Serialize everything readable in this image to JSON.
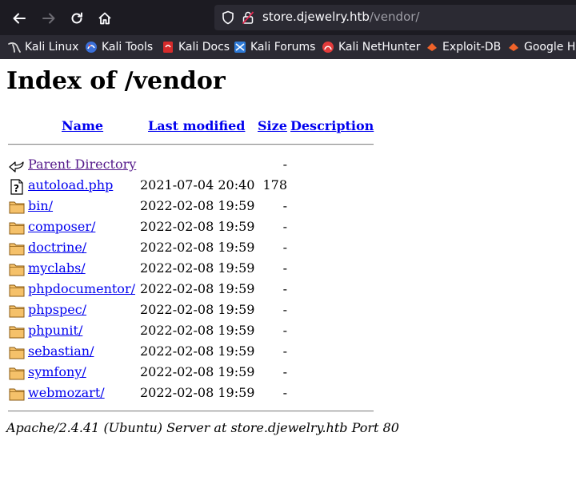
{
  "browser": {
    "url_host": "store.djewelry.htb",
    "url_path": "/vendor/",
    "bookmarks": [
      {
        "label": "Kali Linux",
        "icon": "kali-dragon-icon"
      },
      {
        "label": "Kali Tools",
        "icon": "kali-tools-icon"
      },
      {
        "label": "Kali Docs",
        "icon": "kali-docs-icon"
      },
      {
        "label": "Kali Forums",
        "icon": "kali-forums-icon"
      },
      {
        "label": "Kali NetHunter",
        "icon": "kali-nethunter-icon"
      },
      {
        "label": "Exploit-DB",
        "icon": "exploit-db-icon"
      },
      {
        "label": "Google Ha",
        "icon": "google-hacking-icon"
      }
    ]
  },
  "page": {
    "title": "Index of /vendor",
    "columns": {
      "name": "Name",
      "last_modified": "Last modified",
      "size": "Size",
      "description": "Description"
    },
    "parent": {
      "name": "Parent Directory",
      "size": "-"
    },
    "entries": [
      {
        "name": "autoload.php",
        "date": "2021-07-04 20:40",
        "size": "178",
        "type": "file"
      },
      {
        "name": "bin/",
        "date": "2022-02-08 19:59",
        "size": "-",
        "type": "folder"
      },
      {
        "name": "composer/",
        "date": "2022-02-08 19:59",
        "size": "-",
        "type": "folder"
      },
      {
        "name": "doctrine/",
        "date": "2022-02-08 19:59",
        "size": "-",
        "type": "folder"
      },
      {
        "name": "myclabs/",
        "date": "2022-02-08 19:59",
        "size": "-",
        "type": "folder"
      },
      {
        "name": "phpdocumentor/",
        "date": "2022-02-08 19:59",
        "size": "-",
        "type": "folder"
      },
      {
        "name": "phpspec/",
        "date": "2022-02-08 19:59",
        "size": "-",
        "type": "folder"
      },
      {
        "name": "phpunit/",
        "date": "2022-02-08 19:59",
        "size": "-",
        "type": "folder"
      },
      {
        "name": "sebastian/",
        "date": "2022-02-08 19:59",
        "size": "-",
        "type": "folder"
      },
      {
        "name": "symfony/",
        "date": "2022-02-08 19:59",
        "size": "-",
        "type": "folder"
      },
      {
        "name": "webmozart/",
        "date": "2022-02-08 19:59",
        "size": "-",
        "type": "folder"
      }
    ],
    "footer": "Apache/2.4.41 (Ubuntu) Server at store.djewelry.htb Port 80"
  },
  "colors": {
    "toolbar_bg": "#1c1b22",
    "urlbar_bg": "#2b2a33",
    "link": "#0000ee",
    "visited_link": "#551a8b"
  }
}
